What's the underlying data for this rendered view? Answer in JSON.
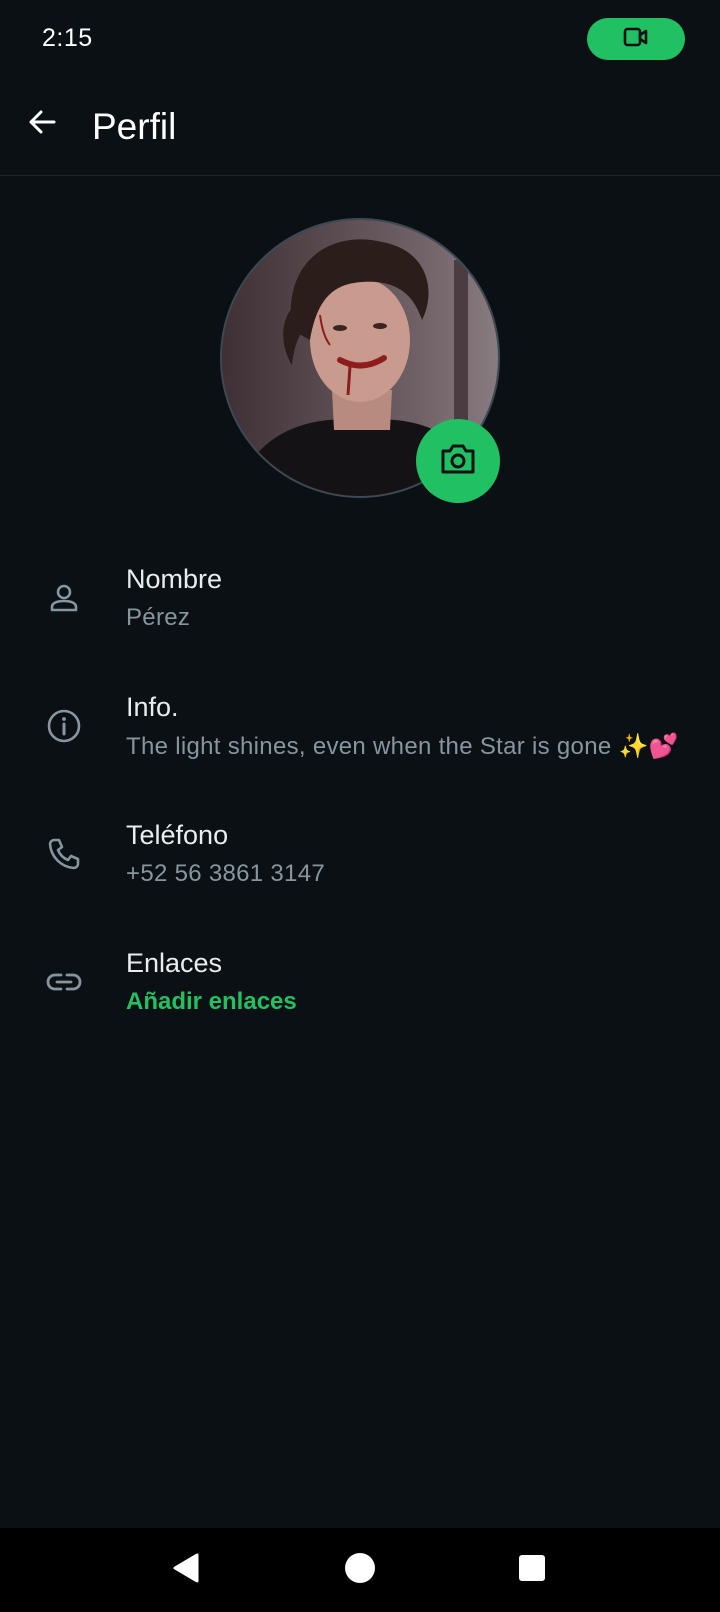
{
  "status": {
    "time": "2:15"
  },
  "header": {
    "title": "Perfil"
  },
  "rows": [
    {
      "label": "Nombre",
      "value": "Pérez"
    },
    {
      "label": "Info.",
      "value": "The light shines, even when the Star is gone ✨💕"
    },
    {
      "label": "Teléfono",
      "value": "+52 56 3861 3147"
    },
    {
      "label": "Enlaces",
      "value": "Añadir enlaces"
    }
  ],
  "colors": {
    "background": "#0b1014",
    "accent": "#21c063",
    "secondary_text": "#8696a0"
  },
  "icons": {
    "call": "videocam-icon",
    "back": "arrow-left-icon",
    "camera": "camera-icon",
    "name": "person-icon",
    "info": "info-icon",
    "phone": "phone-icon",
    "links": "link-icon"
  }
}
